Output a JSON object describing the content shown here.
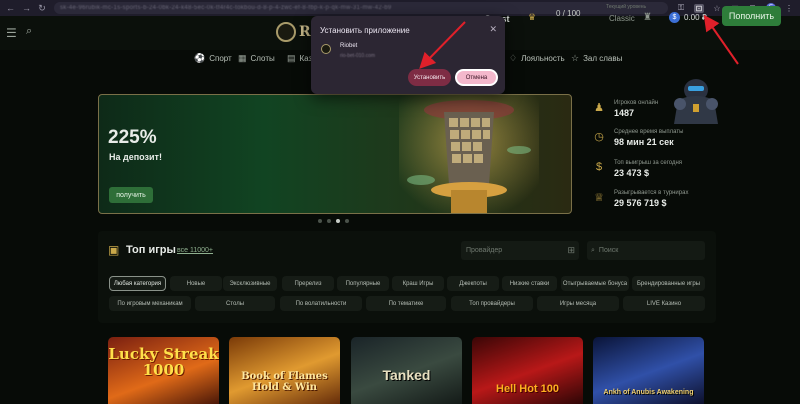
{
  "browser": {
    "url": "sk-4e-96rubik-mc-1s-sports-b-24-0bk-24-k48-5ec-0k-tf4r4c-tokbou-d-8-p-4-zwc-ef-8-fbp-k-p-qk-mw-31-mw-42-b9",
    "avatar_letter": "E"
  },
  "header": {
    "logo_text": "RI",
    "user_name": "Guest",
    "progress": "0 / 100",
    "level_label": "Текущий уровень",
    "level": "Classic",
    "balance": "0.00 ₽",
    "deposit_label": "Пополнить"
  },
  "nav": {
    "items": [
      {
        "label": "Спорт",
        "icon": "ball-icon"
      },
      {
        "label": "Слоты",
        "icon": "slots-icon"
      },
      {
        "label": "Казино",
        "icon": "casino-icon"
      },
      {
        "label": "Лояльность",
        "icon": "loyalty-icon"
      },
      {
        "label": "Зал славы",
        "icon": "star-icon"
      }
    ]
  },
  "popup": {
    "title": "Установить приложение",
    "close": "✕",
    "app_name": "Riobet",
    "app_url": "rio-bet-010.com",
    "install_label": "Установить",
    "cancel_label": "Отмена"
  },
  "banner": {
    "percent": "225%",
    "subtitle": "На депозит!",
    "button_label": "получить",
    "slide_count": 4,
    "active_slide": 2
  },
  "stats": [
    {
      "label": "Игроков онлайн",
      "value": "1487",
      "icon": "player-icon"
    },
    {
      "label": "Среднее время выплаты",
      "value": "98 мин 21 сек",
      "icon": "stopwatch-icon"
    },
    {
      "label": "Топ выигрыш за сегодня",
      "value": "23 473 $",
      "icon": "moneybag-icon"
    },
    {
      "label": "Разыгрывается в турнирах",
      "value": "29 576 719 $",
      "icon": "trophy-icon"
    }
  ],
  "top_games": {
    "title": "Топ игры",
    "all_link": "все 11000+",
    "provider_placeholder": "Провайдер",
    "search_placeholder": "Поиск",
    "categories_row1": [
      "Любая категория",
      "Новые",
      "Эксклюзивные",
      "Пререлиз",
      "Популярные",
      "Краш Игры",
      "Джекпоты",
      "Низкие ставки",
      "Отыгрываемые бонуса",
      "Брендированные игры"
    ],
    "categories_row2": [
      "По игровым механикам",
      "Столы",
      "По волатильности",
      "По тематике",
      "Топ провайдеры",
      "Игры месяца",
      "LIVE Казино"
    ],
    "active_category": "Любая категория"
  },
  "games": [
    {
      "title": "Lucky Streak 1000"
    },
    {
      "title": "Book of Flames Hold & Win"
    },
    {
      "title": "Tanked"
    },
    {
      "title": "Hell Hot 100"
    },
    {
      "title": "Ankh of Anubis Awakening"
    }
  ],
  "colors": {
    "accent_green": "#2e7d3a",
    "gold": "#c9a84a",
    "arrow_red": "#e0202a"
  }
}
